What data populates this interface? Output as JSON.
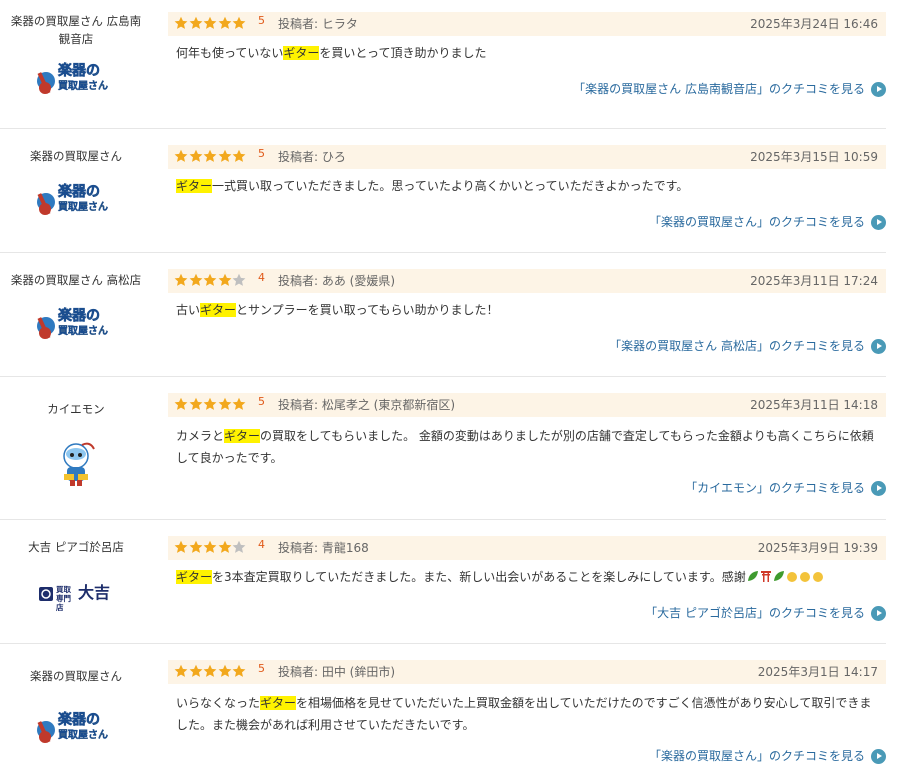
{
  "reviews": [
    {
      "shop": "楽器の買取屋さん 広島南観音店",
      "logo": "gakki-logo",
      "rating": "5",
      "stars": 5,
      "poster": "投稿者: ヒラタ",
      "date": "2025年3月24日 16:46",
      "text_parts": [
        "何年も使っていない",
        "ギター",
        "を買いとって頂き助かりました"
      ],
      "link": "「楽器の買取屋さん 広島南観音店」のクチコミを見る"
    },
    {
      "shop": "楽器の買取屋さん",
      "logo": "gakki-logo",
      "rating": "5",
      "stars": 5,
      "poster": "投稿者: ひろ",
      "date": "2025年3月15日 10:59",
      "text_parts": [
        "",
        "ギター",
        "一式買い取っていただきました。思っていたより高くかいとっていただきよかったです。"
      ],
      "link": "「楽器の買取屋さん」のクチコミを見る"
    },
    {
      "shop": "楽器の買取屋さん 高松店",
      "logo": "gakki-logo",
      "rating": "4",
      "stars": 4,
      "poster": "投稿者: ああ (愛媛県)",
      "date": "2025年3月11日 17:24",
      "text_parts": [
        "古い",
        "ギター",
        "とサンプラーを買い取ってもらい助かりました！"
      ],
      "link": "「楽器の買取屋さん 高松店」のクチコミを見る"
    },
    {
      "shop": "カイエモン",
      "logo": "kaiemon-mascot",
      "rating": "5",
      "stars": 5,
      "poster": "投稿者: 松尾孝之 (東京都新宿区)",
      "date": "2025年3月11日 14:18",
      "text_parts": [
        "カメラと",
        "ギター",
        "の買取をしてもらいました。 金額の変動はありましたが別の店舗で査定してもらった金額よりも高くこちらに依頼して良かったです。"
      ],
      "link": "「カイエモン」のクチコミを見る"
    },
    {
      "shop": "大吉 ピアゴ於呂店",
      "logo": "daikichi-logo",
      "logo_text_small": "買取専門店",
      "logo_text_big": "大吉",
      "rating": "4",
      "stars": 4,
      "poster": "投稿者: 青龍168",
      "date": "2025年3月9日 19:39",
      "text_parts": [
        "",
        "ギター",
        "を3本査定買取りしていただきました。また、新しい出会いがあることを楽しみにしています。感謝"
      ],
      "link": "「大吉 ピアゴ於呂店」のクチコミを見る"
    },
    {
      "shop": "楽器の買取屋さん",
      "logo": "gakki-logo",
      "rating": "5",
      "stars": 5,
      "poster": "投稿者: 田中 (鉾田市)",
      "date": "2025年3月1日 14:17",
      "text_parts": [
        "いらなくなった",
        "ギター",
        "を相場価格を見せていただいた上買取金額を出していただけたのですごく信憑性があり安心して取引できました。また機会があれば利用させていただきたいです。"
      ],
      "link": "「楽器の買取屋さん」のクチコミを見る"
    }
  ],
  "gakki_logo_text": [
    "楽器の",
    "買取屋さん"
  ],
  "colors": {
    "star_on": "#f2a81d",
    "star_off": "#bfbfbf",
    "highlight": "#fff200",
    "link": "#2a6a9e",
    "header_bg": "#fdf4e6"
  }
}
